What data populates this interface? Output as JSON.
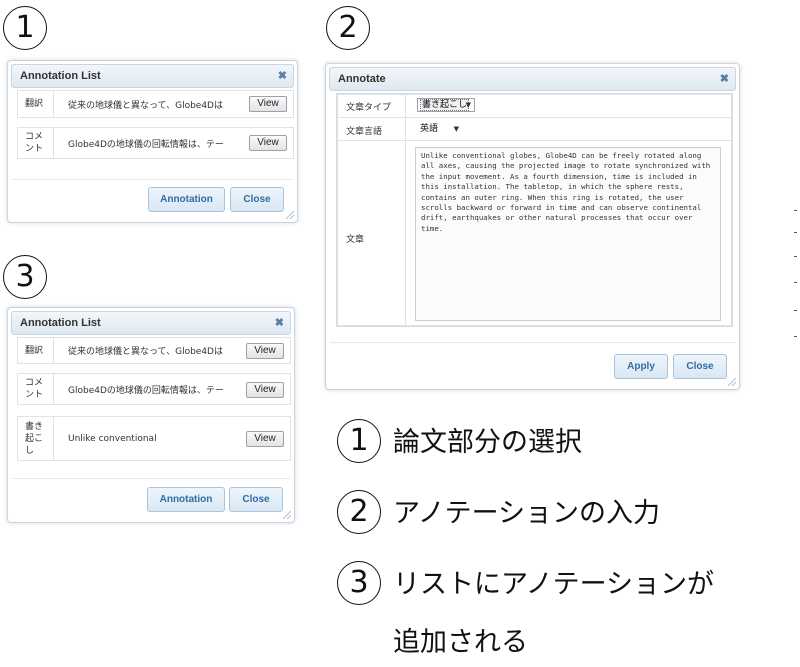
{
  "steps": {
    "one": "1",
    "two": "2",
    "three": "3"
  },
  "dialog1": {
    "title": "Annotation List",
    "close_glyph": "✖",
    "rows": [
      {
        "label": "翻訳",
        "content": "従来の地球儀と異なって、Globe4Dは",
        "button": "View"
      },
      {
        "label": "コメント",
        "content": "Globe4Dの地球儀の回転情報は、テー",
        "button": "View"
      }
    ],
    "annotation_button": "Annotation",
    "close_button": "Close"
  },
  "dialog2": {
    "title": "Annotate",
    "close_glyph": "✖",
    "type_label": "文章タイプ",
    "type_value": "書き起こし",
    "lang_label": "文章言語",
    "lang_value": "英語",
    "text_label": "文章",
    "text_value": "Unlike conventional globes, Globe4D can be freely rotated along all axes, causing the projected image to rotate synchronized with the input movement. As a fourth dimension, time is included in this installation. The tabletop, in which the sphere rests, contains an outer ring. When this ring is rotated, the user scrolls backward or forward in time and can observe continental drift, earthquakes or other natural processes that occur over time.",
    "apply_button": "Apply",
    "close_button": "Close"
  },
  "dialog3": {
    "title": "Annotation List",
    "close_glyph": "✖",
    "rows": [
      {
        "label": "翻訳",
        "content": "従来の地球儀と異なって、Globe4Dは",
        "button": "View"
      },
      {
        "label": "コメント",
        "content": "Globe4Dの地球儀の回転情報は、テー",
        "button": "View"
      },
      {
        "label": "書き起こし",
        "content": "Unlike conventional",
        "button": "View"
      }
    ],
    "annotation_button": "Annotation",
    "close_button": "Close"
  },
  "legend": {
    "item1_num": "1",
    "item1_text": "論文部分の選択",
    "item2_num": "2",
    "item2_text": "アノテーションの入力",
    "item3_num": "3",
    "item3_text_line1": "リストにアノテーションが",
    "item3_text_line2": "追加される"
  }
}
